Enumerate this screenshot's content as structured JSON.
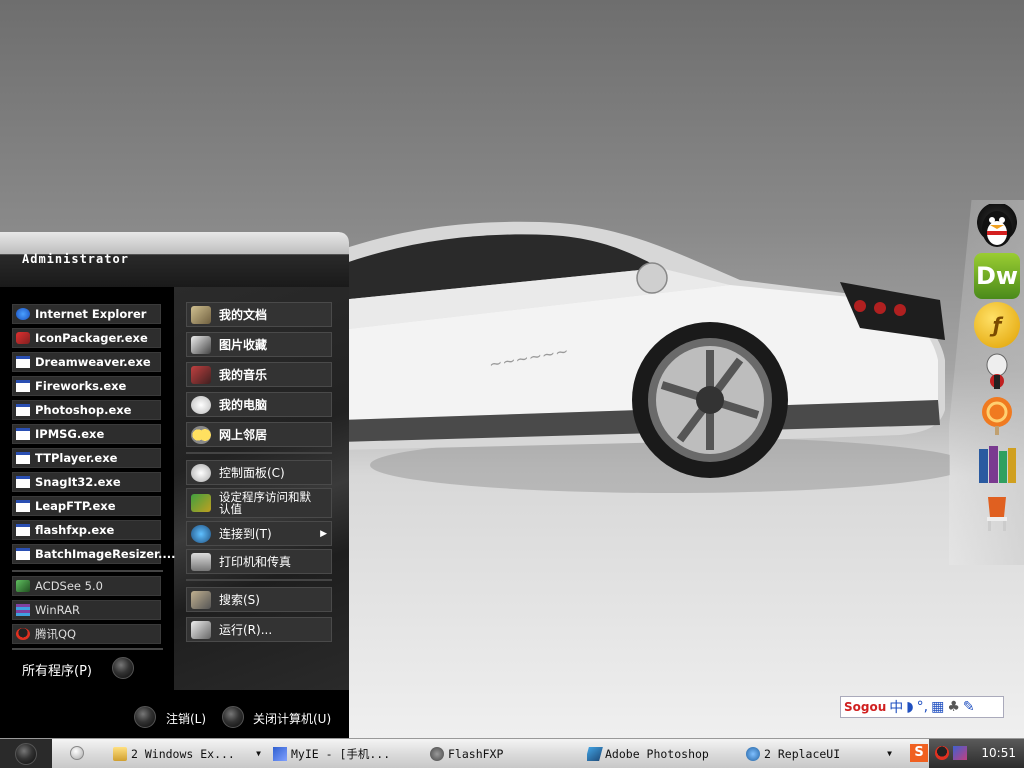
{
  "start_menu": {
    "username": "Administrator",
    "pinned_apps": [
      {
        "label": "Internet Explorer",
        "icon": "ie-icon"
      },
      {
        "label": "IconPackager.exe",
        "icon": "iconpackager-icon"
      },
      {
        "label": "Dreamweaver.exe",
        "icon": "window-icon"
      },
      {
        "label": "Fireworks.exe",
        "icon": "window-icon"
      },
      {
        "label": "Photoshop.exe",
        "icon": "window-icon"
      },
      {
        "label": "IPMSG.exe",
        "icon": "window-icon"
      },
      {
        "label": "TTPlayer.exe",
        "icon": "window-icon"
      },
      {
        "label": "SnagIt32.exe",
        "icon": "window-icon"
      },
      {
        "label": "LeapFTP.exe",
        "icon": "window-icon"
      },
      {
        "label": "flashfxp.exe",
        "icon": "window-icon"
      },
      {
        "label": "BatchImageResizer....",
        "icon": "window-icon"
      }
    ],
    "recent_apps": [
      {
        "label": "ACDSee 5.0",
        "icon": "acdsee-icon"
      },
      {
        "label": "WinRAR",
        "icon": "winrar-icon"
      },
      {
        "label": "腾讯QQ",
        "icon": "qq-icon"
      }
    ],
    "all_programs": "所有程序(P)",
    "places": [
      {
        "label": "我的文档",
        "icon": "documents-icon"
      },
      {
        "label": "图片收藏",
        "icon": "pictures-icon"
      },
      {
        "label": "我的音乐",
        "icon": "music-icon"
      },
      {
        "label": "我的电脑",
        "icon": "computer-icon"
      },
      {
        "label": "网上邻居",
        "icon": "network-icon"
      }
    ],
    "system": [
      {
        "label": "控制面板(C)",
        "icon": "control-panel-icon"
      },
      {
        "label": "设定程序访问和默认值",
        "icon": "program-access-icon"
      },
      {
        "label": "连接到(T)",
        "icon": "connect-icon"
      },
      {
        "label": "打印机和传真",
        "icon": "printer-icon"
      },
      {
        "label": "搜索(S)",
        "icon": "search-icon"
      },
      {
        "label": "运行(R)...",
        "icon": "run-icon"
      }
    ],
    "logoff": "注销(L)",
    "shutdown": "关闭计算机(U)"
  },
  "taskbar": {
    "tasks": [
      {
        "label": "2 Windows Ex...",
        "icon": "folder-icon",
        "group": true
      },
      {
        "label": "MyIE - [手机...",
        "icon": "myie-icon",
        "group": false
      },
      {
        "label": "FlashFXP",
        "icon": "flashfxp-icon",
        "group": false
      },
      {
        "label": "Adobe Photoshop",
        "icon": "photoshop-icon",
        "group": false
      },
      {
        "label": "2 ReplaceUI",
        "icon": "replaceui-icon",
        "group": true
      }
    ],
    "clock": "10:51"
  },
  "dock": {
    "items": [
      "qq-icon",
      "dreamweaver-icon",
      "flash-icon",
      "messenger-icon",
      "lollipop-icon",
      "books-icon",
      "chair-icon"
    ],
    "dw_label": "Dw"
  },
  "sogou": {
    "brand": "Sogou",
    "mode": "中"
  },
  "colors": {
    "menu_bg": "#1a1a1a",
    "taskbar_bg": "#dcdcdc",
    "tray_bg": "#3a3a3a"
  }
}
